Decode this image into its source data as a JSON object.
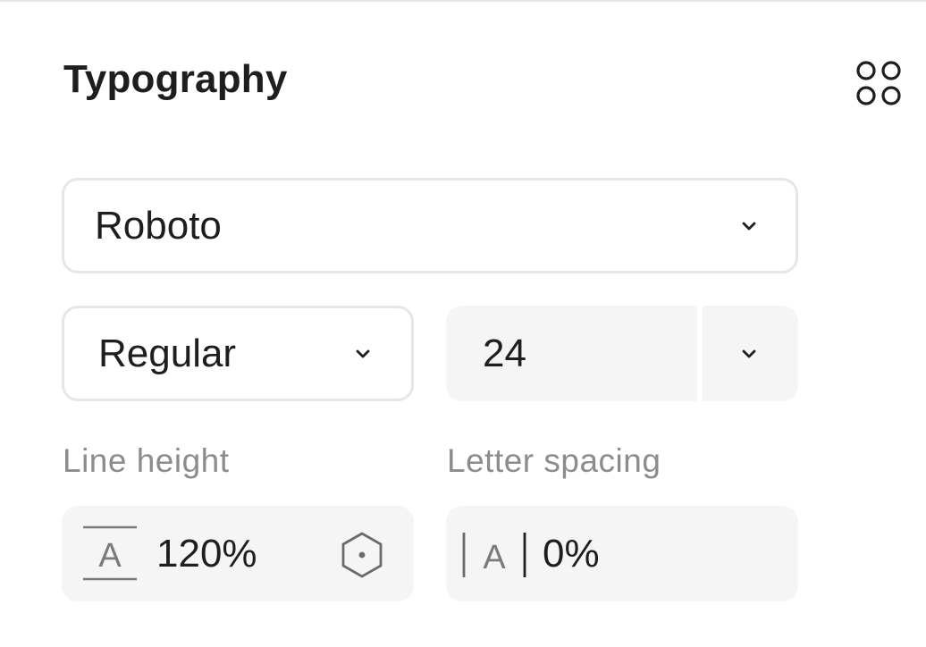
{
  "typography": {
    "title": "Typography",
    "styles_icon": "four-circles-icon",
    "font_family": {
      "selected": "Roboto",
      "icon": "chevron-down-icon"
    },
    "font_weight": {
      "selected": "Regular",
      "icon": "chevron-down-icon"
    },
    "font_size": {
      "value": "24",
      "icon": "chevron-down-icon"
    },
    "line_height": {
      "label": "Line height",
      "value": "120%",
      "icon": "line-height-icon",
      "variable_icon": "hexagon-variable-icon"
    },
    "letter_spacing": {
      "label": "Letter spacing",
      "value": "0%",
      "icon": "letter-spacing-icon"
    }
  }
}
